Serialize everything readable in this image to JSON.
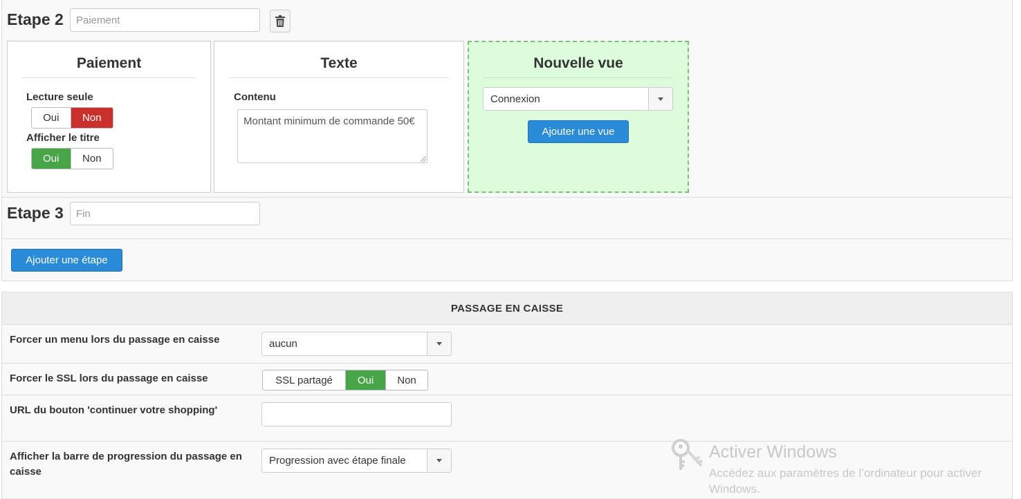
{
  "steps": [
    {
      "title": "Etape 2",
      "name_placeholder": "Paiement",
      "views": [
        {
          "title": "Paiement",
          "fields": [
            {
              "label": "Lecture seule",
              "options": [
                "Oui",
                "Non"
              ],
              "selected": "Non"
            },
            {
              "label": "Afficher le titre",
              "options": [
                "Oui",
                "Non"
              ],
              "selected": "Oui"
            }
          ]
        },
        {
          "title": "Texte",
          "content_label": "Contenu",
          "content_value": "Montant minimum de commande 50€"
        }
      ],
      "new_view": {
        "title": "Nouvelle vue",
        "select_value": "Connexion",
        "add_button": "Ajouter une vue"
      }
    },
    {
      "title": "Etape 3",
      "name_placeholder": "Fin"
    }
  ],
  "add_step_button": "Ajouter une étape",
  "checkout": {
    "header": "PASSAGE EN CAISSE",
    "rows": [
      {
        "label": "Forcer un menu lors du passage en caisse",
        "select_value": "aucun"
      },
      {
        "label": "Forcer le SSL lors du passage en caisse",
        "options": [
          "SSL partagé",
          "Oui",
          "Non"
        ],
        "selected": "Oui"
      },
      {
        "label": "URL du bouton 'continuer votre shopping'",
        "input_value": ""
      },
      {
        "label": "Afficher la barre de progression du passage en caisse",
        "select_value": "Progression avec étape finale"
      }
    ]
  },
  "watermark": {
    "title": "Activer Windows",
    "subtitle": "Accédez aux paramètres de l’ordinateur pour activer",
    "subtitle2": "Windows."
  },
  "colors": {
    "primary": "#2a8bd8",
    "danger": "#c9302c",
    "success": "#47a447",
    "new_view_bg": "#dcfcdc",
    "new_view_border": "#7bbf7b"
  }
}
